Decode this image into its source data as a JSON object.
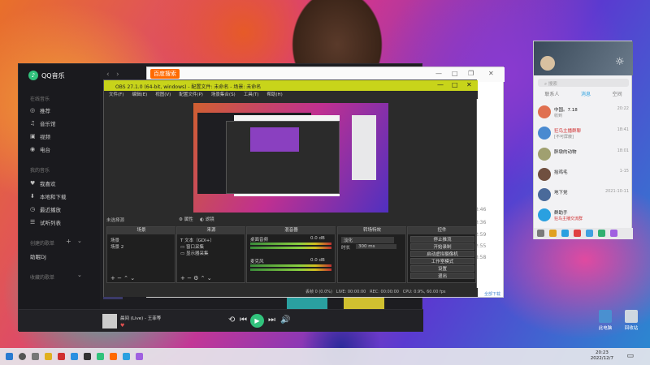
{
  "qqmusic": {
    "logo": "QQ音乐",
    "sections": {
      "online": "在线音乐",
      "mine": "我的音乐",
      "created": "创建的歌单",
      "collected": "收藏的歌单"
    },
    "online_items": [
      "推荐",
      "音乐馆",
      "视频",
      "电台"
    ],
    "my_items": [
      "我喜欢",
      "本地和下载",
      "最近播放",
      "试听列表"
    ],
    "playlist": "助眠DJ",
    "now_playing": {
      "title": "晨间 (Live)",
      "artist": "王菲等"
    }
  },
  "browser": {
    "logo": "百度搜索",
    "side_items": [
      "官",
      "03:46",
      "03:36",
      "02:59",
      "02:55",
      "03:58"
    ],
    "link": "全部下载"
  },
  "obs": {
    "title": "OBS 27.1.0 (64-bit, windows) - 配置文件: 未命名 - 场景: 未命名",
    "menu": [
      "文件(F)",
      "编辑(E)",
      "视图(V)",
      "配置文件(P)",
      "场景集合(S)",
      "工具(T)",
      "帮助(H)"
    ],
    "no_source": "未选择源",
    "prop_btn": "属性",
    "filter_btn": "滤镜",
    "docks": {
      "scenes": "场景",
      "sources": "来源",
      "mixer": "混音器",
      "transitions": "转场特效",
      "controls": "控件"
    },
    "scenes": [
      "场景",
      "场景 2"
    ],
    "sources": [
      "文本（GDI+）",
      "窗口采集",
      "显示器采集"
    ],
    "mixer": [
      {
        "name": "桌面音频",
        "db": "0.0 dB"
      },
      {
        "name": "麦克风",
        "db": "0.0 dB"
      }
    ],
    "transition": {
      "type": "淡化",
      "duration_label": "时长",
      "duration": "300 ms"
    },
    "controls": [
      "停止推流",
      "开始录制",
      "启动虚拟摄像机",
      "工作室模式",
      "设置",
      "退出"
    ],
    "status": {
      "drop": "丢帧 0 (0.0%)",
      "live": "LIVE: 00:00:00",
      "rec": "REC: 00:00:00",
      "cpu": "CPU: 0.9%, 60.00 fps"
    }
  },
  "qq": {
    "search": "搜索",
    "tabs": [
      "联系人",
      "消息",
      "空间"
    ],
    "chats": [
      {
        "name": "中国。7.18",
        "msg": "收到",
        "time": "20:22",
        "color": "#e07050"
      },
      {
        "name": "狂鸟主播群聊",
        "msg": "[不可屏蔽]",
        "time": "18:41",
        "color": "#4a8ad0"
      },
      {
        "name": "胖墩的动物",
        "msg": "",
        "time": "18:01",
        "color": "#a0a070"
      },
      {
        "name": "抬鸡毛",
        "msg": "",
        "time": "1-15",
        "color": "#705040"
      },
      {
        "name": "地下党",
        "msg": "",
        "time": "2021-10-11",
        "color": "#4a6a9a"
      },
      {
        "name": "群助手",
        "msg": "狂鸟主播交流群",
        "time": "",
        "color": "#2aa0e0"
      }
    ]
  },
  "desktop": {
    "icons": [
      "此电脑",
      "回收站"
    ]
  },
  "taskbar": {
    "time": "20:23",
    "date": "2022/12/7"
  },
  "colors": {
    "accent_green": "#31c27c",
    "obs_title": "#c8d41a"
  }
}
